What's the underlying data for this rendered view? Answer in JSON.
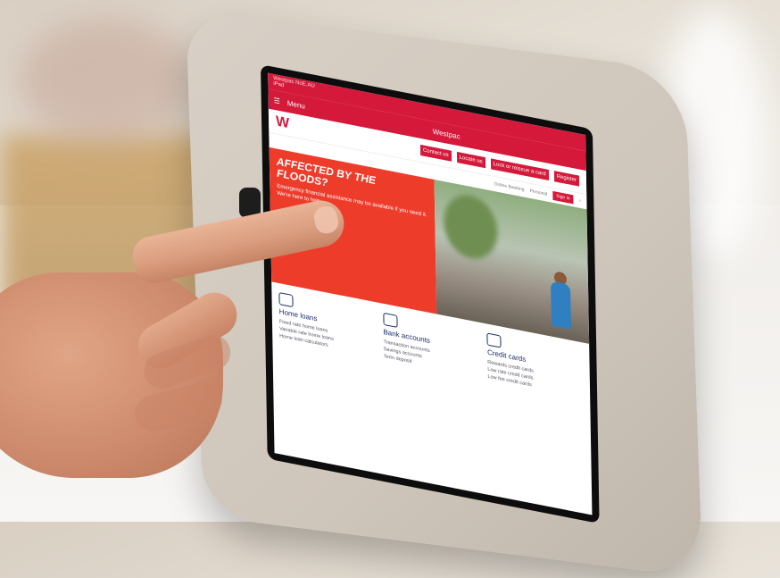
{
  "ipad": {
    "statusbar": "Westpac  NoE.AU",
    "app_label": "iPad",
    "menu_label": "Menu",
    "nav_title": "Westpac"
  },
  "site": {
    "logo": "W",
    "top_links": [
      "Contact us",
      "Locate us",
      "Lock or reissue a card",
      "Register"
    ],
    "sub_links": [
      "Online Banking",
      "Personal",
      "Sign in"
    ],
    "hero_title": "AFFECTED BY THE FLOODS?",
    "hero_text": "Emergency financial assistance may be available if you need it. We're here to help.",
    "products": [
      {
        "title": "Home loans",
        "links": [
          "Fixed rate home loans",
          "Variable rate home loans",
          "Home loan calculators"
        ]
      },
      {
        "title": "Bank accounts",
        "links": [
          "Transaction accounts",
          "Savings accounts",
          "Term deposit"
        ]
      },
      {
        "title": "Credit cards",
        "links": [
          "Rewards credit cards",
          "Low rate credit cards",
          "Low fee credit cards"
        ]
      }
    ]
  },
  "colors": {
    "brand_red": "#d5193a",
    "hero_red": "#ee3c2b",
    "navy": "#1b2a6b"
  }
}
